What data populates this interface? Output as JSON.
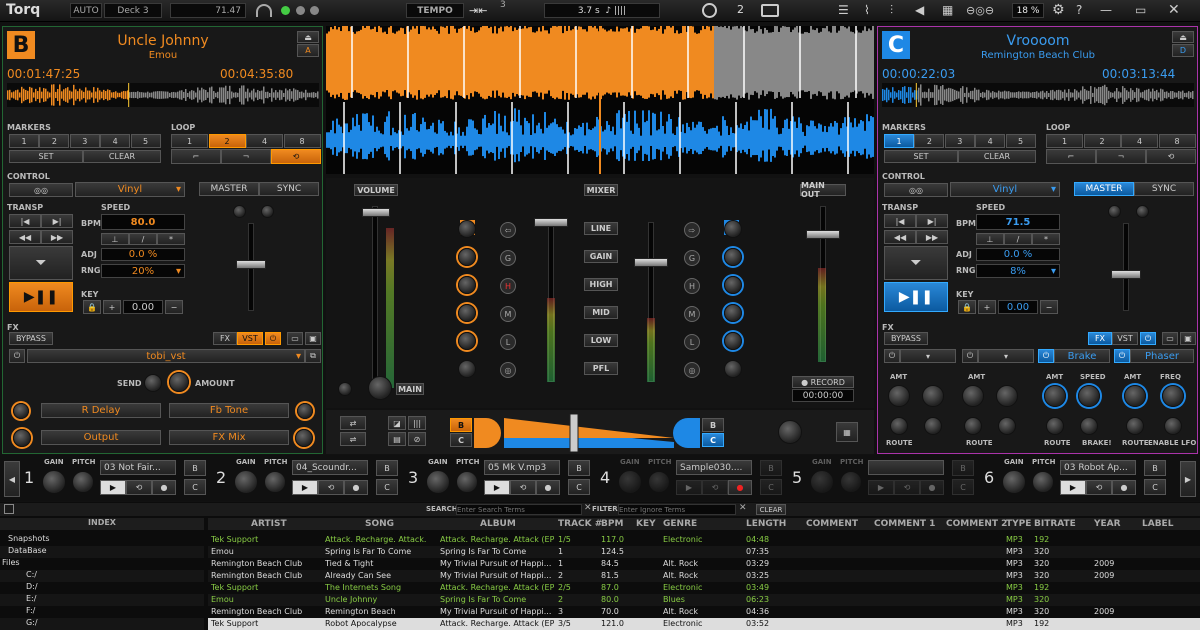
{
  "app": {
    "title": "Torq",
    "mode": "AUTO",
    "deck_select": "Deck 3",
    "bpm_top": "71.47",
    "tempo_label": "TEMPO",
    "tempo_num": "3",
    "loop_time": "3.7 s",
    "count": "2",
    "cpu": "18 %"
  },
  "deckB": {
    "letter": "B",
    "channel": "A",
    "title": "Uncle Johnny",
    "artist": "Emou",
    "elapsed": "00:01:47:25",
    "total": "00:04:35:80",
    "markers_label": "MARKERS",
    "markers": [
      "1",
      "2",
      "3",
      "4",
      "5"
    ],
    "set": "SET",
    "clear": "CLEAR",
    "loop_label": "LOOP",
    "loops": [
      "1",
      "2",
      "4",
      "8"
    ],
    "control_label": "CONTROL",
    "control": "Vinyl",
    "master": "MASTER",
    "sync": "SYNC",
    "transp": "TRANSP",
    "speed": "SPEED",
    "bpm_label": "BPM",
    "bpm": "80.0",
    "adj_label": "ADJ",
    "adj": "0.0 %",
    "rng_label": "RNG",
    "rng": "20%",
    "key_label": "KEY",
    "key": "0.00",
    "fx_label": "FX",
    "bypass": "BYPASS",
    "fx": "FX",
    "vst": "VST",
    "vst_name": "tobi_vst",
    "send": "SEND",
    "amount": "AMOUNT",
    "p1": "R Delay",
    "p2": "Fb Tone",
    "p3": "Output",
    "p4": "FX Mix",
    "accent": "#f08a20"
  },
  "deckC": {
    "letter": "C",
    "channel": "D",
    "title": "Vroooom",
    "artist": "Remington Beach Club",
    "elapsed": "00:00:22:03",
    "total": "00:03:13:44",
    "markers_label": "MARKERS",
    "markers": [
      "1",
      "2",
      "3",
      "4",
      "5"
    ],
    "set": "SET",
    "clear": "CLEAR",
    "loop_label": "LOOP",
    "loops": [
      "1",
      "2",
      "4",
      "8"
    ],
    "control_label": "CONTROL",
    "control": "Vinyl",
    "master": "MASTER",
    "sync": "SYNC",
    "transp": "TRANSP",
    "speed": "SPEED",
    "bpm_label": "BPM",
    "bpm": "71.5",
    "adj_label": "ADJ",
    "adj": "0.0 %",
    "rng_label": "RNG",
    "rng": "8%",
    "key_label": "KEY",
    "key": "0.00",
    "fx_label": "FX",
    "bypass": "BYPASS",
    "fx": "FX",
    "vst": "VST",
    "fx_sel1": "Brake",
    "fx_sel2": "Phaser",
    "amt": "AMT",
    "route": "ROUTE",
    "speed_k": "SPEED",
    "brake": "BRAKE!",
    "freq": "FREQ",
    "enable_lfo": "ENABLE LFO",
    "accent": "#1e88e5"
  },
  "mixer": {
    "volume": "VOLUME",
    "mixer": "MIXER",
    "main_out": "MAIN OUT",
    "main": "MAIN",
    "record": "RECORD",
    "rec_time": "00:00:00",
    "rows": [
      "LINE",
      "GAIN",
      "HIGH",
      "MID",
      "LOW",
      "PFL"
    ],
    "eq": [
      "G",
      "H",
      "M",
      "L"
    ],
    "b": "B",
    "c": "C"
  },
  "samplers": [
    {
      "num": "1",
      "name": "03 Not Fair...",
      "active": true
    },
    {
      "num": "2",
      "name": "04_Scoundr...",
      "active": true
    },
    {
      "num": "3",
      "name": "05 Mk V.mp3",
      "active": true
    },
    {
      "num": "4",
      "name": "Sample030....",
      "active": false
    },
    {
      "num": "5",
      "name": "",
      "active": false
    },
    {
      "num": "6",
      "name": "03 Robot Ap...",
      "active": true
    }
  ],
  "sampler_labels": {
    "gain": "GAIN",
    "pitch": "PITCH",
    "b": "B",
    "c": "C"
  },
  "browser": {
    "search": "SEARCH",
    "search_ph": "Enter Search Terms",
    "filter": "FILTER",
    "filter_ph": "Enter Ignore Terms",
    "clear": "CLEAR",
    "index": "INDEX",
    "tree": [
      "Snapshots",
      "DataBase",
      "Files",
      "C:/",
      "D:/",
      "E:/",
      "F:/",
      "G:/"
    ],
    "cols": [
      "ARTIST",
      "SONG",
      "ALBUM",
      "TRACK #",
      "BPM",
      "KEY",
      "GENRE",
      "LENGTH",
      "COMMENT",
      "COMMENT 1",
      "COMMENT 2",
      "TYPE",
      "BITRATE",
      "YEAR",
      "LABEL"
    ],
    "rows": [
      [
        "Tek Support",
        "Attack. Recharge. Attack.",
        "Attack. Recharge. Attack (EP)",
        "1/5",
        "117.0",
        "",
        "Electronic",
        "04:48",
        "",
        "",
        "",
        "MP3",
        "192",
        "",
        ""
      ],
      [
        "Emou",
        "Spring Is Far To Come",
        "Spring Is Far To Come",
        "1",
        "124.5",
        "",
        "",
        "07:35",
        "",
        "",
        "",
        "MP3",
        "320",
        "",
        ""
      ],
      [
        "Remington Beach Club",
        "Tied & Tight",
        "My Trivial Pursuit of Happi...",
        "1",
        "84.5",
        "",
        "Alt. Rock",
        "03:29",
        "",
        "",
        "",
        "MP3",
        "320",
        "2009",
        ""
      ],
      [
        "Remington Beach Club",
        "Already Can See",
        "My Trivial Pursuit of Happi...",
        "2",
        "81.5",
        "",
        "Alt. Rock",
        "03:25",
        "",
        "",
        "",
        "MP3",
        "320",
        "2009",
        ""
      ],
      [
        "Tek Support",
        "The Internets Song",
        "Attack. Recharge. Attack (EP)",
        "2/5",
        "87.0",
        "",
        "Electronic",
        "03:49",
        "",
        "",
        "",
        "MP3",
        "192",
        "",
        ""
      ],
      [
        "Emou",
        "Uncle Johnny",
        "Spring Is Far To Come",
        "2",
        "80.0",
        "",
        "Blues",
        "06:23",
        "",
        "",
        "",
        "MP3",
        "320",
        "",
        ""
      ],
      [
        "Remington Beach Club",
        "Remington Beach",
        "My Trivial Pursuit of Happi...",
        "3",
        "70.0",
        "",
        "Alt. Rock",
        "04:36",
        "",
        "",
        "",
        "MP3",
        "320",
        "2009",
        ""
      ],
      [
        "Tek Support",
        "Robot Apocalypse",
        "Attack. Recharge. Attack (EP)",
        "3/5",
        "121.0",
        "",
        "Electronic",
        "03:52",
        "",
        "",
        "",
        "MP3",
        "192",
        "",
        ""
      ]
    ]
  }
}
